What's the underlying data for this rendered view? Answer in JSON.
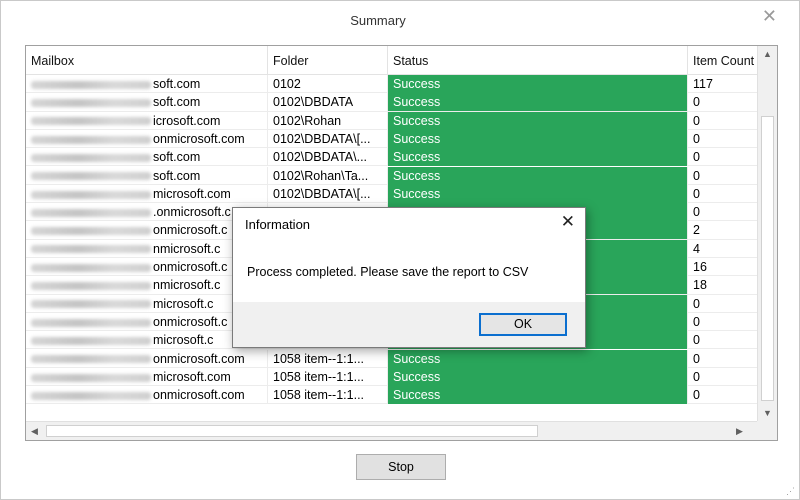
{
  "window": {
    "title": "Summary",
    "close_glyph": "✕"
  },
  "grid": {
    "columns": [
      "Mailbox",
      "Folder",
      "Status",
      "Item Count"
    ],
    "rows": [
      {
        "mailbox_visible": "soft.com",
        "folder": "0102",
        "status": "Success",
        "count": "117"
      },
      {
        "mailbox_visible": "soft.com",
        "folder": "0102\\DBDATA",
        "status": "Success",
        "count": "0"
      },
      {
        "mailbox_visible": "icrosoft.com",
        "folder": "0102\\Rohan",
        "status": "Success",
        "count": "0"
      },
      {
        "mailbox_visible": "onmicrosoft.com",
        "folder": "0102\\DBDATA\\[...",
        "status": "Success",
        "count": "0"
      },
      {
        "mailbox_visible": "soft.com",
        "folder": "0102\\DBDATA\\...",
        "status": "Success",
        "count": "0"
      },
      {
        "mailbox_visible": "soft.com",
        "folder": "0102\\Rohan\\Ta...",
        "status": "Success",
        "count": "0"
      },
      {
        "mailbox_visible": "microsoft.com",
        "folder": "0102\\DBDATA\\[...",
        "status": "Success",
        "count": "0"
      },
      {
        "mailbox_visible": ".onmicrosoft.c",
        "folder": "",
        "status": "",
        "count": "0"
      },
      {
        "mailbox_visible": "onmicrosoft.c",
        "folder": "",
        "status": "",
        "count": "2"
      },
      {
        "mailbox_visible": "nmicrosoft.c",
        "folder": "",
        "status": "",
        "count": "4"
      },
      {
        "mailbox_visible": "onmicrosoft.c",
        "folder": "",
        "status": "",
        "count": "16"
      },
      {
        "mailbox_visible": "nmicrosoft.c",
        "folder": "",
        "status": "",
        "count": "18"
      },
      {
        "mailbox_visible": "microsoft.c",
        "folder": "",
        "status": "",
        "count": "0"
      },
      {
        "mailbox_visible": "onmicrosoft.c",
        "folder": "",
        "status": "",
        "count": "0"
      },
      {
        "mailbox_visible": "microsoft.c",
        "folder": "",
        "status": "",
        "count": "0"
      },
      {
        "mailbox_visible": "onmicrosoft.com",
        "folder": "1058 item--1:1...",
        "status": "Success",
        "count": "0"
      },
      {
        "mailbox_visible": "microsoft.com",
        "folder": "1058 item--1:1...",
        "status": "Success",
        "count": "0"
      },
      {
        "mailbox_visible": "onmicrosoft.com",
        "folder": "1058 item--1:1...",
        "status": "Success",
        "count": "0"
      }
    ]
  },
  "footer": {
    "stop_label": "Stop"
  },
  "dialog": {
    "title": "Information",
    "message": "Process completed. Please save the report to CSV",
    "ok_label": "OK",
    "close_glyph": "✕"
  },
  "colors": {
    "success": "#29a55a",
    "focus_border": "#0b6fcf"
  }
}
